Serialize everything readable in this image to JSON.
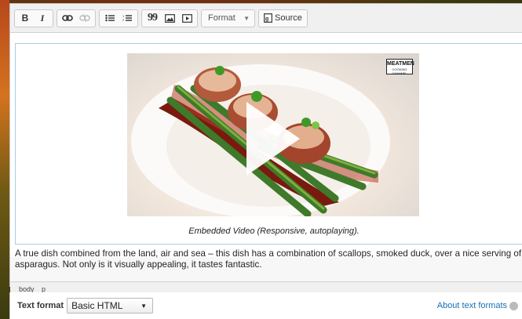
{
  "toolbar": {
    "bold_label": "B",
    "italic_label": "I",
    "blockquote_label": "99",
    "format_label": "Format",
    "source_label": "Source"
  },
  "video": {
    "logo_text": "MEATMEN",
    "logo_sub": "COOKING CHANNEL",
    "caption": "Embedded Video (Responsive, autoplaying)."
  },
  "content": {
    "paragraph_line1": "A true dish combined from the land, air and sea – this dish has a combination of scallops, smoked duck, over a nice serving of",
    "paragraph_line2": "asparagus. Not only is it visually appealing, it tastes fantastic."
  },
  "statusbar": {
    "path": [
      "body",
      "p"
    ]
  },
  "footer": {
    "text_format_label": "Text format",
    "text_format_value": "Basic HTML",
    "about_link": "About text formats"
  }
}
